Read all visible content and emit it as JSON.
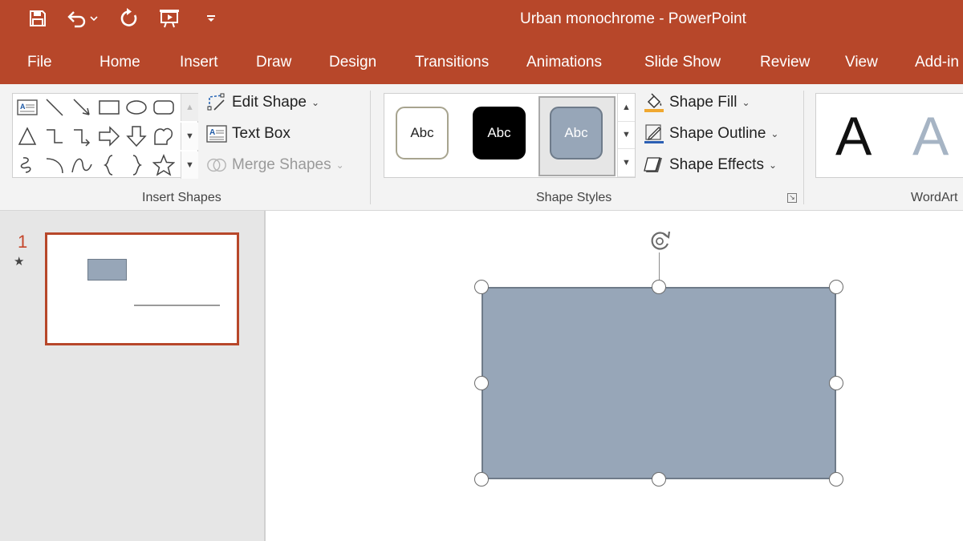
{
  "window": {
    "title": "Urban monochrome  -  PowerPoint",
    "accent_color": "#b7472a"
  },
  "quick_access": {
    "icons": [
      "save-icon",
      "undo-icon",
      "undo-dropdown-icon",
      "redo-icon",
      "present-from-beginning-icon",
      "customize-qat-icon"
    ]
  },
  "tabs": [
    "File",
    "Home",
    "Insert",
    "Draw",
    "Design",
    "Transitions",
    "Animations",
    "Slide Show",
    "Review",
    "View",
    "Add-in"
  ],
  "ribbon": {
    "insert_shapes": {
      "label": "Insert Shapes",
      "edit_shape": "Edit Shape",
      "text_box": "Text Box",
      "merge_shapes": "Merge Shapes"
    },
    "shape_styles": {
      "label": "Shape Styles",
      "swatch_text": "Abc",
      "swatches": [
        {
          "fill": "#ffffff",
          "border": "#a7a48f",
          "text_color": "#222222"
        },
        {
          "fill": "#000000",
          "border": "#000000",
          "text_color": "#ffffff"
        },
        {
          "fill": "#97a6b8",
          "border": "#6e7b8a",
          "text_color": "#ffffff",
          "selected": true
        }
      ],
      "shape_fill": "Shape Fill",
      "shape_outline": "Shape Outline",
      "shape_effects": "Shape Effects"
    },
    "wordart": {
      "label": "WordArt",
      "sample_letter": "A"
    }
  },
  "slides": {
    "items": [
      {
        "number": "1",
        "has_animation": true
      }
    ]
  },
  "canvas": {
    "shape_fill": "#97a6b8",
    "shape_border": "#6f7b89"
  }
}
